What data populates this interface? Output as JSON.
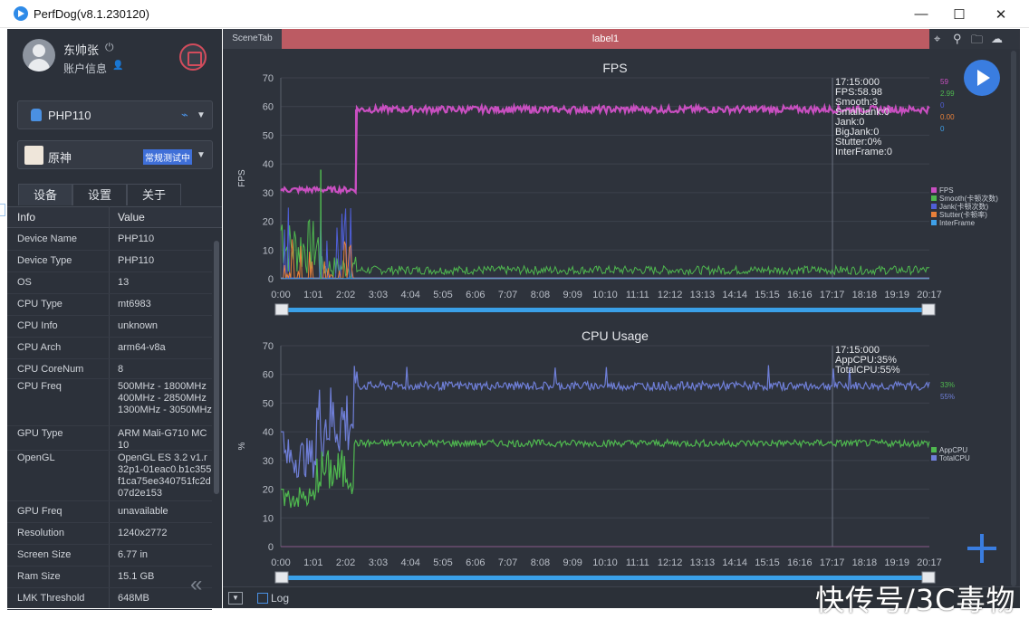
{
  "window": {
    "title": "PerfDog(v8.1.230120)",
    "minimize": "—",
    "maximize": "☐",
    "close": "✕"
  },
  "user": {
    "name": "东帅张",
    "account": "账户信息"
  },
  "device": {
    "name": "PHP110"
  },
  "app": {
    "name": "原神",
    "mode": "常规测试中"
  },
  "tabs": [
    "设备",
    "设置",
    "关于"
  ],
  "info": {
    "header": {
      "key": "Info",
      "value": "Value"
    },
    "rows": [
      {
        "k": "Device Name",
        "v": "PHP110"
      },
      {
        "k": "Device Type",
        "v": "PHP110"
      },
      {
        "k": "OS",
        "v": "13"
      },
      {
        "k": "CPU Type",
        "v": "mt6983"
      },
      {
        "k": "CPU Info",
        "v": "unknown"
      },
      {
        "k": "CPU Arch",
        "v": "arm64-v8a"
      },
      {
        "k": "CPU CoreNum",
        "v": "8"
      },
      {
        "k": "CPU Freq",
        "v": "500MHz - 1800MHz 400MHz - 2850MHz 1300MHz - 3050MHz"
      },
      {
        "k": "GPU Type",
        "v": "ARM Mali-G710 MC10"
      },
      {
        "k": "OpenGL",
        "v": "OpenGL ES 3.2 v1.r32p1-01eac0.b1c355f1ca75ee340751fc2d07d2e153"
      },
      {
        "k": "GPU Freq",
        "v": "unavailable"
      },
      {
        "k": "Resolution",
        "v": "1240x2772"
      },
      {
        "k": "Screen Size",
        "v": "6.77 in"
      },
      {
        "k": "Ram Size",
        "v": "15.1 GB"
      },
      {
        "k": "LMK Threshold",
        "v": "648MB"
      }
    ]
  },
  "scene": {
    "tab": "SceneTab",
    "label": "label1"
  },
  "bottom": {
    "log": "Log"
  },
  "watermark": "快传号/3C毒物",
  "colors": {
    "fps": "#c94fc1",
    "smooth": "#4fb84f",
    "jank": "#4f5fd8",
    "stutter": "#e8803a",
    "interframe": "#3fa0e8",
    "appcpu": "#4fb84f",
    "totalcpu": "#6f7fd8",
    "accent": "#3a7de0",
    "label_bar": "#bc5b63"
  },
  "chart_data": [
    {
      "type": "line",
      "title": "FPS",
      "ylabel": "FPS",
      "ylim": [
        0,
        70
      ],
      "yticks": [
        "0",
        "10",
        "20",
        "30",
        "40",
        "50",
        "60",
        "70"
      ],
      "xticks": [
        "0:00",
        "1:01",
        "2:02",
        "3:03",
        "4:04",
        "5:05",
        "6:06",
        "7:07",
        "8:08",
        "9:09",
        "10:10",
        "11:11",
        "12:12",
        "13:13",
        "14:14",
        "15:15",
        "16:16",
        "17:17",
        "18:18",
        "19:19",
        "20:17"
      ],
      "cursor": {
        "time": "17:15:000",
        "lines": [
          "17:15:000",
          "FPS:58.98",
          "Smooth:3",
          "SmallJank:0",
          "Jank:0",
          "BigJank:0",
          "Stutter:0%",
          "InterFrame:0"
        ]
      },
      "right_values": [
        "59",
        "2.99",
        "0",
        "0.00",
        "0"
      ],
      "legend": [
        "FPS",
        "Smooth(卡顿次数)",
        "Jank(卡顿次数)",
        "Stutter(卡顿率)",
        "InterFrame"
      ],
      "series": [
        {
          "name": "FPS",
          "segments": [
            {
              "x": [
                0,
                2.35
              ],
              "y": 31
            },
            {
              "x": [
                2.35,
                20.28
              ],
              "y": 59
            }
          ]
        },
        {
          "name": "Smooth(卡顿次数)",
          "typical": 3,
          "peak": 38
        },
        {
          "name": "Jank(卡顿次数)",
          "typical": 0
        },
        {
          "name": "Stutter(卡顿率)",
          "typical": 0,
          "peak": 17
        },
        {
          "name": "InterFrame",
          "typical": 0
        }
      ]
    },
    {
      "type": "line",
      "title": "CPU Usage",
      "ylabel": "%",
      "ylim": [
        0,
        70
      ],
      "yticks": [
        "0",
        "10",
        "20",
        "30",
        "40",
        "50",
        "60",
        "70"
      ],
      "xticks": [
        "0:00",
        "1:01",
        "2:02",
        "3:03",
        "4:04",
        "5:05",
        "6:06",
        "7:07",
        "8:08",
        "9:09",
        "10:10",
        "11:11",
        "12:12",
        "13:13",
        "14:14",
        "15:15",
        "16:16",
        "17:17",
        "18:18",
        "19:19",
        "20:17"
      ],
      "cursor": {
        "time": "17:15:000",
        "lines": [
          "17:15:000",
          "AppCPU:35%",
          "TotalCPU:55%"
        ]
      },
      "right_values": [
        "33%",
        "55%"
      ],
      "legend": [
        "AppCPU",
        "TotalCPU"
      ],
      "series": [
        {
          "name": "AppCPU",
          "typical": 36
        },
        {
          "name": "TotalCPU",
          "typical": 56
        }
      ]
    }
  ]
}
